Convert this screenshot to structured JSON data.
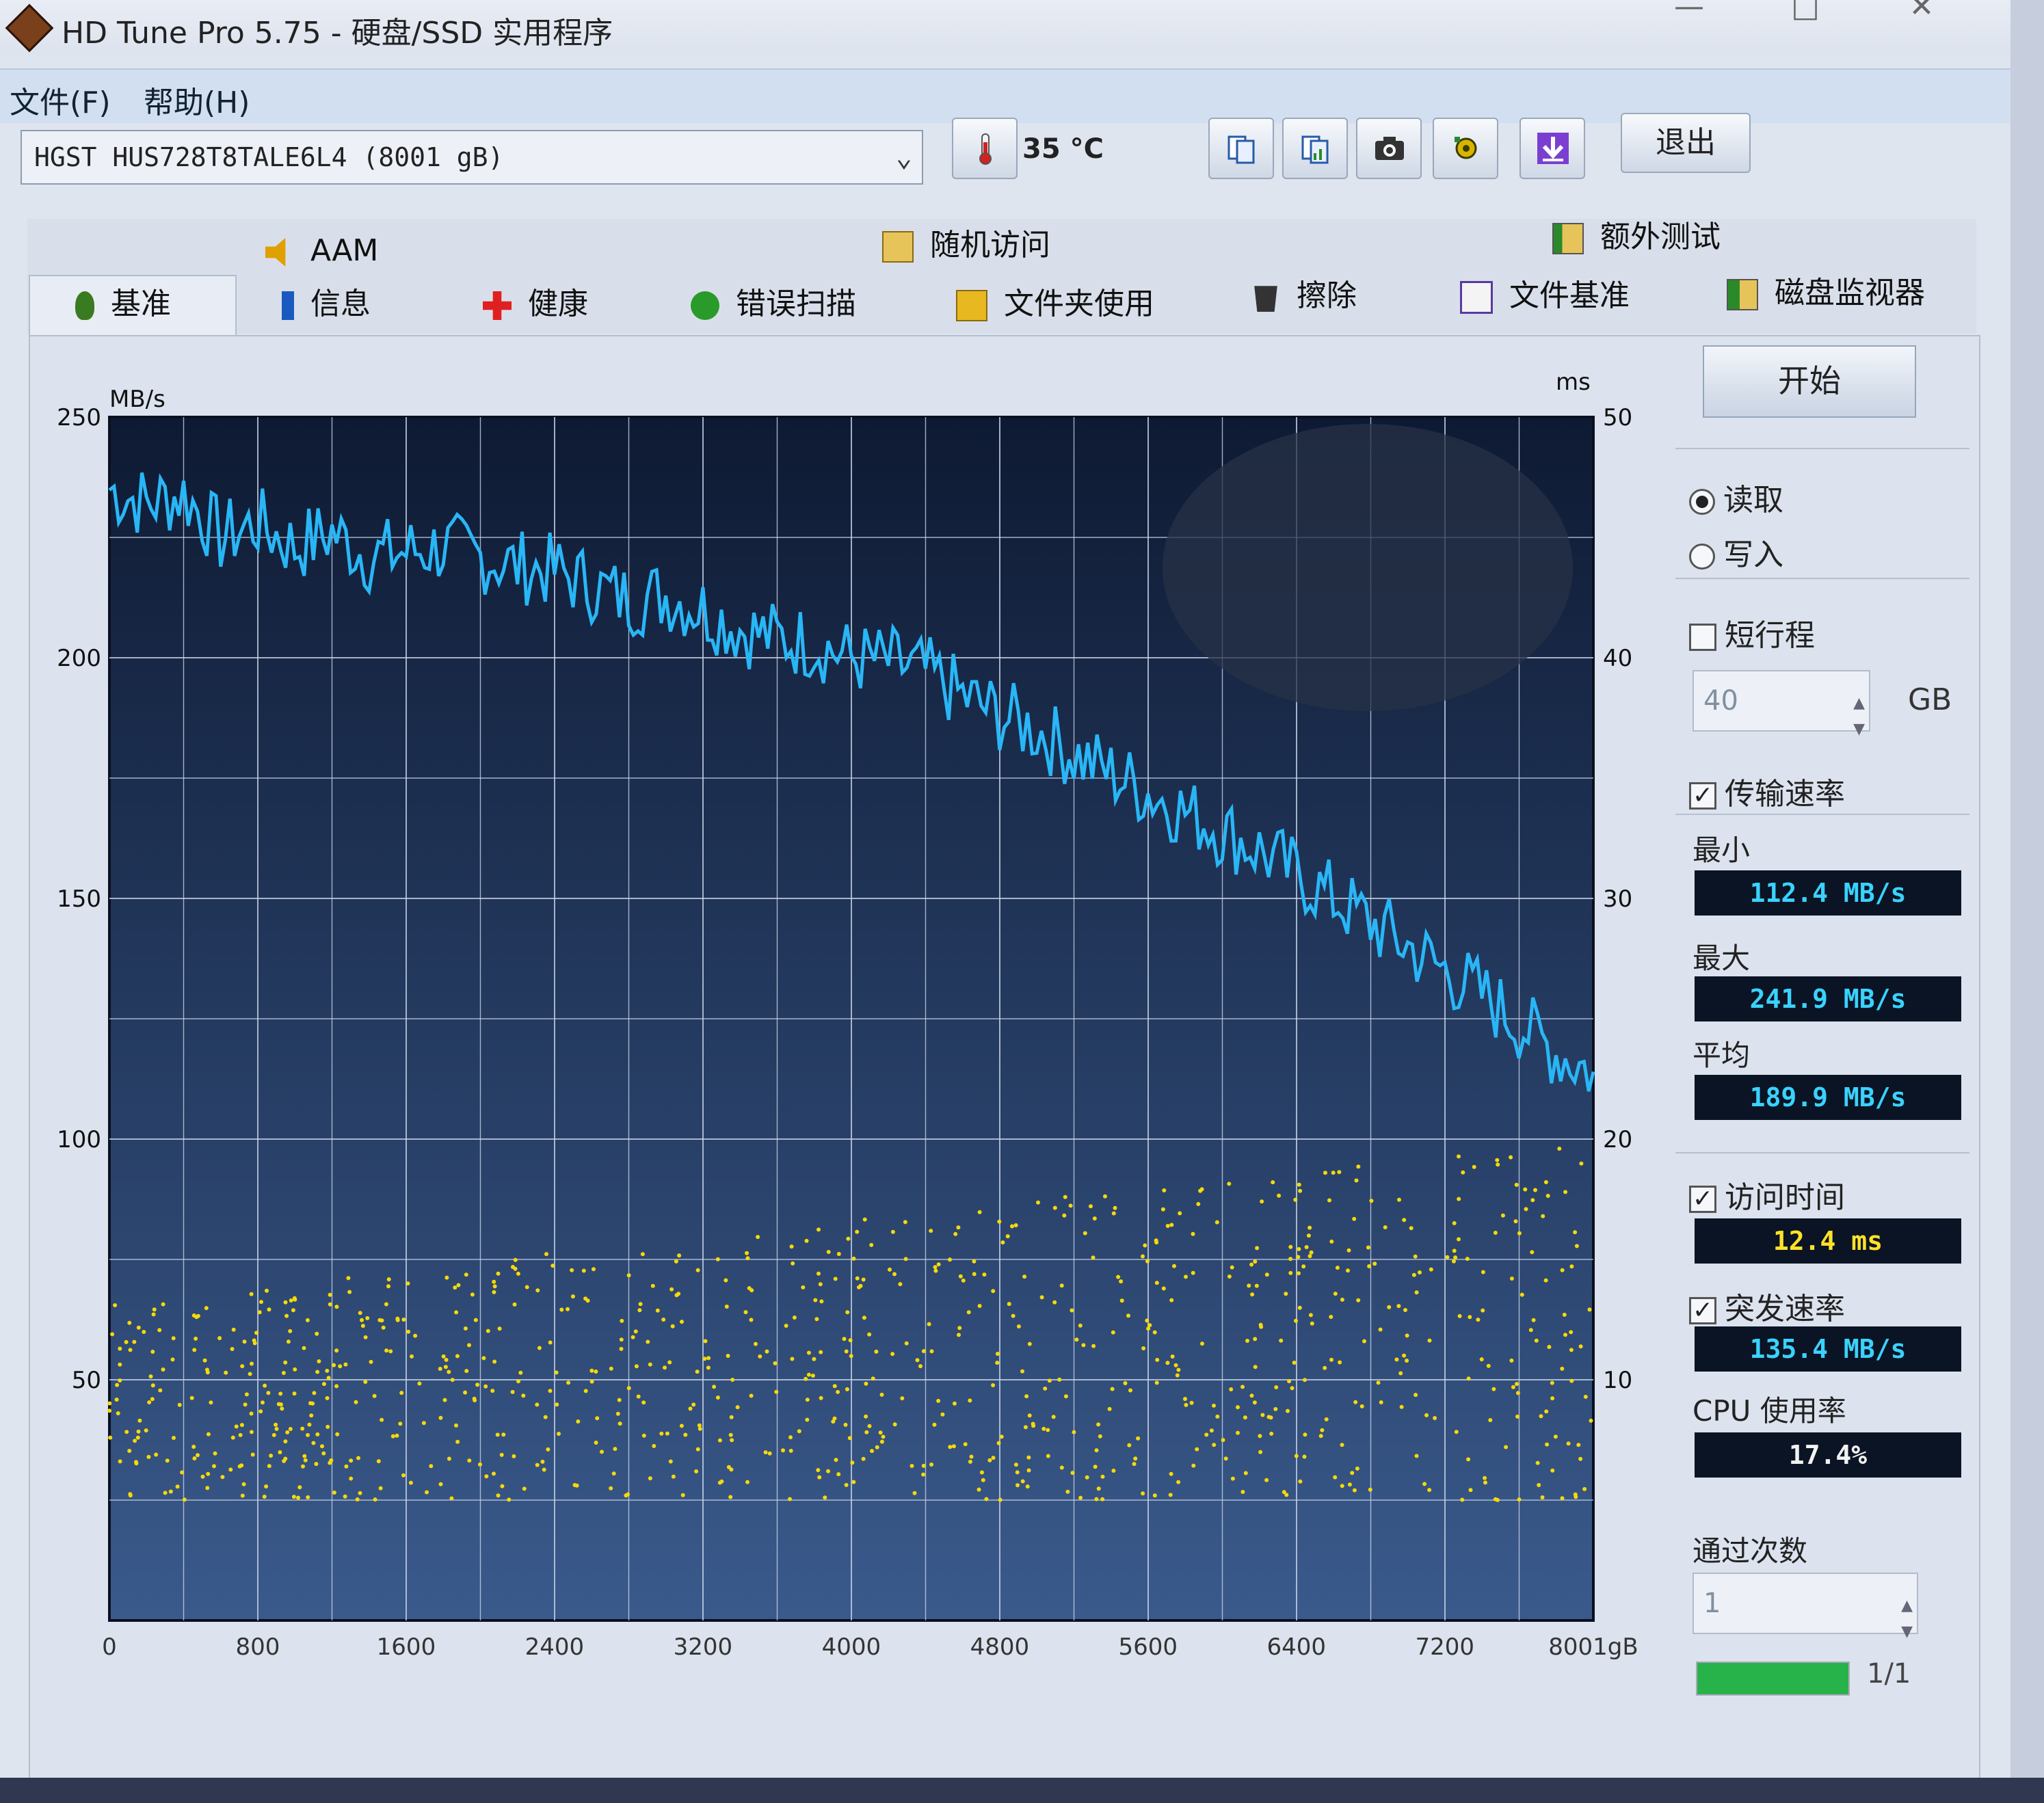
{
  "window": {
    "title": "HD Tune Pro 5.75 - 硬盘/SSD 实用程序"
  },
  "menu": {
    "file": "文件(F)",
    "help": "帮助(H)"
  },
  "toolbar": {
    "drive": "HGST HUS728T8TALE6L4 (8001 gB)",
    "temperature": "35 °C",
    "exit_label": "退出"
  },
  "tabs": {
    "top": [
      {
        "label": "AAM",
        "icon": "speaker-icon"
      },
      {
        "label": "随机访问",
        "icon": "random-access-icon"
      },
      {
        "label": "额外测试",
        "icon": "extra-tests-icon"
      }
    ],
    "bottom": [
      {
        "label": "基准",
        "icon": "benchmark-icon"
      },
      {
        "label": "信息",
        "icon": "info-icon"
      },
      {
        "label": "健康",
        "icon": "health-icon"
      },
      {
        "label": "错误扫描",
        "icon": "error-scan-icon"
      },
      {
        "label": "文件夹使用",
        "icon": "folder-usage-icon"
      },
      {
        "label": "擦除",
        "icon": "erase-icon"
      },
      {
        "label": "文件基准",
        "icon": "file-benchmark-icon"
      },
      {
        "label": "磁盘监视器",
        "icon": "disk-monitor-icon"
      }
    ]
  },
  "side": {
    "start_label": "开始",
    "read_label": "读取",
    "write_label": "写入",
    "short_stroke_label": "短行程",
    "short_stroke_value": "40",
    "short_stroke_unit": "GB",
    "transfer_rate_label": "传输速率",
    "min_label": "最小",
    "min_value": "112.4 MB/s",
    "max_label": "最大",
    "max_value": "241.9 MB/s",
    "avg_label": "平均",
    "avg_value": "189.9 MB/s",
    "access_time_label": "访问时间",
    "access_time_value": "12.4 ms",
    "burst_rate_label": "突发速率",
    "burst_rate_value": "135.4 MB/s",
    "cpu_label": "CPU 使用率",
    "cpu_value": "17.4%",
    "passes_label": "通过次数",
    "passes_value": "1",
    "progress_label": "1/1",
    "progress_fraction": 1.0
  },
  "colors": {
    "chart_bg_top": "#0e1a33",
    "chart_bg_bottom": "#3a5a8c",
    "transfer_line": "#29b6f6",
    "access_points": "#f5d90a",
    "grid": "#c8d4e8"
  },
  "chart_data": {
    "type": "line",
    "left_unit": "MB/s",
    "right_unit": "ms",
    "x_unit": "gB",
    "y_ticks": [
      "250",
      "200",
      "150",
      "100",
      "50"
    ],
    "y2_ticks": [
      "50",
      "40",
      "30",
      "20",
      "10"
    ],
    "x_ticks": [
      "0",
      "800",
      "1600",
      "2400",
      "3200",
      "4000",
      "4800",
      "5600",
      "6400",
      "7200",
      "8001gB"
    ],
    "ylim": [
      0,
      250
    ],
    "y2lim": [
      0,
      50
    ],
    "xlim": [
      0,
      8001
    ],
    "grid": true,
    "series": [
      {
        "name": "传输速率",
        "x": [
          0,
          200,
          400,
          600,
          800,
          1000,
          1200,
          1400,
          1600,
          1800,
          2000,
          2200,
          2400,
          2600,
          2800,
          3000,
          3200,
          3400,
          3600,
          3800,
          4000,
          4200,
          4400,
          4600,
          4800,
          5000,
          5200,
          5400,
          5600,
          5800,
          6000,
          6200,
          6400,
          6600,
          6800,
          7000,
          7200,
          7400,
          7600,
          7800,
          8001
        ],
        "y": [
          235,
          232,
          234,
          225,
          228,
          223,
          226,
          221,
          222,
          223,
          221,
          219,
          218,
          215,
          212,
          213,
          210,
          206,
          204,
          203,
          200,
          199,
          197,
          192,
          188,
          185,
          180,
          176,
          172,
          168,
          164,
          160,
          155,
          150,
          145,
          140,
          135,
          130,
          124,
          118,
          114
        ]
      }
    ],
    "access_time_ms_range": [
      5,
      20
    ],
    "access_time_avg_ms": 12.4
  }
}
